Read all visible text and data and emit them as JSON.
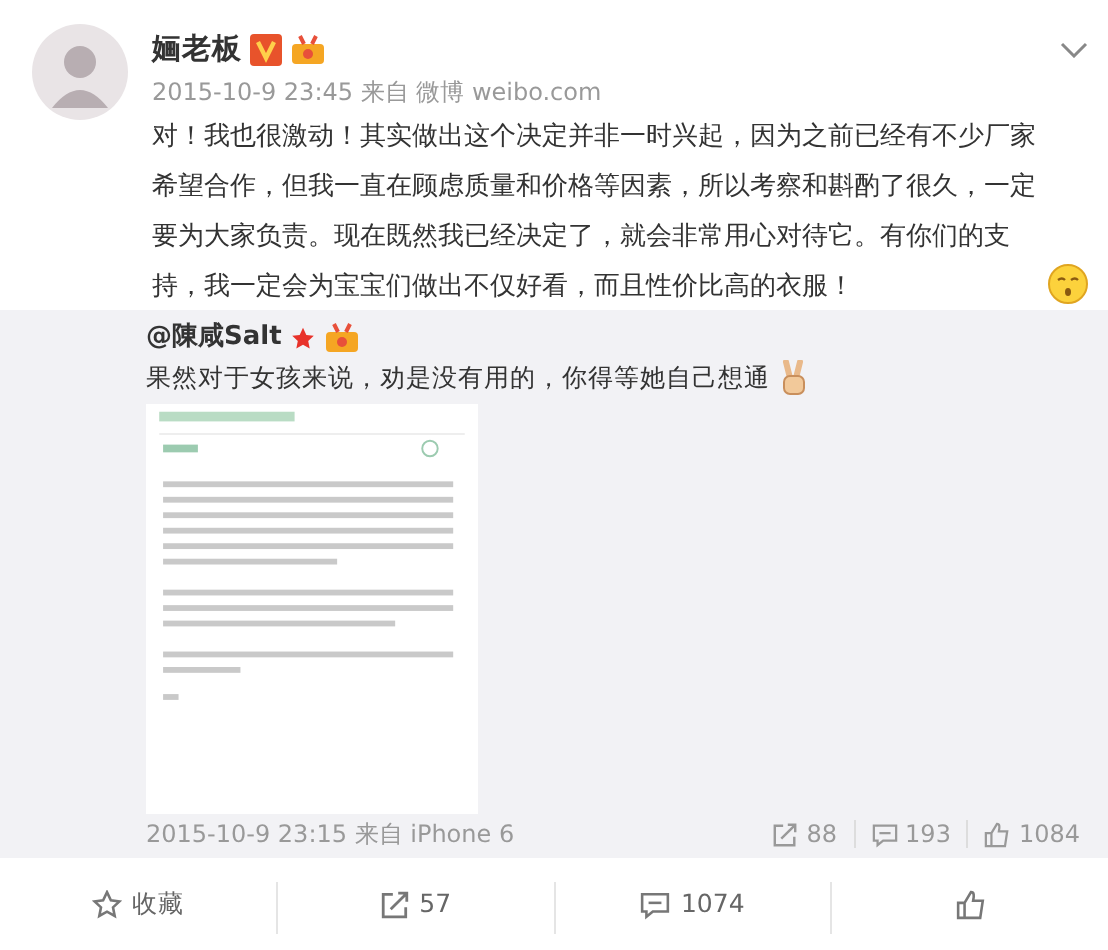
{
  "post": {
    "author": "婳老板",
    "verified": true,
    "meta": "2015-10-9 23:45 来自 微博 weibo.com",
    "text": "对！我也很激动！其实做出这个决定并非一时兴起，因为之前已经有不少厂家希望合作，但我一直在顾虑质量和价格等因素，所以考察和斟酌了很久，一定要为大家负责。现在既然我已经决定了，就会非常用心对待它。有你们的支持，我一定会为宝宝们做出不仅好看，而且性价比高的衣服！",
    "repost": {
      "author": "@陳咸Salt",
      "text": "果然对于女孩来说，劝是没有用的，你得等她自己想通",
      "meta": "2015-10-9 23:15 来自 iPhone 6",
      "stats": [
        {
          "kind": "repost",
          "label": "88"
        },
        {
          "kind": "comment",
          "label": "193"
        },
        {
          "kind": "like",
          "label": "1084"
        }
      ]
    }
  },
  "actions": [
    {
      "kind": "favorite",
      "label": "收藏"
    },
    {
      "kind": "repost",
      "label": "57"
    },
    {
      "kind": "comment",
      "label": "1074"
    },
    {
      "kind": "like"
    }
  ]
}
